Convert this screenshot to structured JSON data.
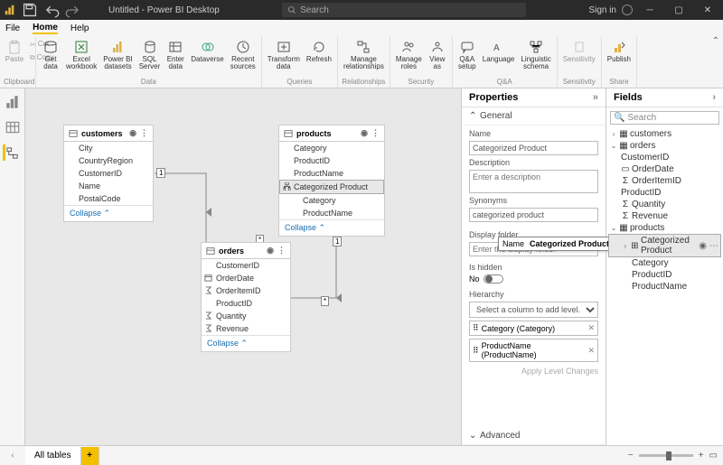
{
  "titlebar": {
    "title": "Untitled - Power BI Desktop",
    "searchPlaceholder": "Search",
    "signIn": "Sign in"
  },
  "menubar": {
    "file": "File",
    "home": "Home",
    "help": "Help"
  },
  "ribbon": {
    "clipboard": {
      "paste": "Paste",
      "cut": "Cut",
      "copy": "Copy",
      "label": "Clipboard"
    },
    "data": {
      "getData": "Get\ndata",
      "excel": "Excel\nworkbook",
      "pbids": "Power BI\ndatasets",
      "sql": "SQL\nServer",
      "enter": "Enter\ndata",
      "dataverse": "Dataverse",
      "recent": "Recent\nsources",
      "label": "Data"
    },
    "queries": {
      "transform": "Transform\ndata",
      "refresh": "Refresh",
      "label": "Queries"
    },
    "relationships": {
      "manage": "Manage\nrelationships",
      "label": "Relationships"
    },
    "security": {
      "roles": "Manage\nroles",
      "viewAs": "View\nas",
      "label": "Security"
    },
    "qa": {
      "setup": "Q&A\nsetup",
      "lang": "Language",
      "schema": "Linguistic\nschema",
      "label": "Q&A"
    },
    "sensitivity": {
      "btn": "Sensitivity",
      "label": "Sensitivity"
    },
    "share": {
      "publish": "Publish",
      "label": "Share"
    }
  },
  "canvas": {
    "customers": {
      "title": "customers",
      "fields": [
        "City",
        "CountryRegion",
        "CustomerID",
        "Name",
        "PostalCode"
      ],
      "collapse": "Collapse"
    },
    "products": {
      "title": "products",
      "fields": [
        "Category",
        "ProductID",
        "ProductName"
      ],
      "hier": "Categorized Product",
      "hierKids": [
        "Category",
        "ProductName"
      ],
      "collapse": "Collapse"
    },
    "orders": {
      "title": "orders",
      "fields": [
        "CustomerID",
        "OrderDate",
        "OrderItemID",
        "ProductID",
        "Quantity",
        "Revenue"
      ],
      "collapse": "Collapse"
    },
    "rel": {
      "one": "1",
      "many": "*"
    }
  },
  "props": {
    "title": "Properties",
    "general": "General",
    "nameLabel": "Name",
    "nameValue": "Categorized Product",
    "descLabel": "Description",
    "descPh": "Enter a description",
    "synLabel": "Synonyms",
    "synValue": "categorized product",
    "folderLabel": "Display folder",
    "folderPh": "Enter the display folder",
    "hiddenLabel": "Is hidden",
    "hiddenNo": "No",
    "hierLabel": "Hierarchy",
    "hierPh": "Select a column to add level...",
    "lvlCat": "Category (Category)",
    "lvlProd": "ProductName (ProductName)",
    "apply": "Apply Level Changes",
    "advanced": "Advanced",
    "tooltipLabel": "Name",
    "tooltipValue": "Categorized Product"
  },
  "fields": {
    "title": "Fields",
    "searchPh": "Search",
    "customers": "customers",
    "orders": "orders",
    "ordersFields": [
      "CustomerID",
      "OrderDate",
      "OrderItemID",
      "ProductID",
      "Quantity",
      "Revenue"
    ],
    "products": "products",
    "prodHier": "Categorized Product",
    "prodHierKids": [
      "Category",
      "ProductID",
      "ProductName"
    ]
  },
  "bottom": {
    "allTables": "All tables",
    "plus": "+",
    "minus": "−"
  }
}
